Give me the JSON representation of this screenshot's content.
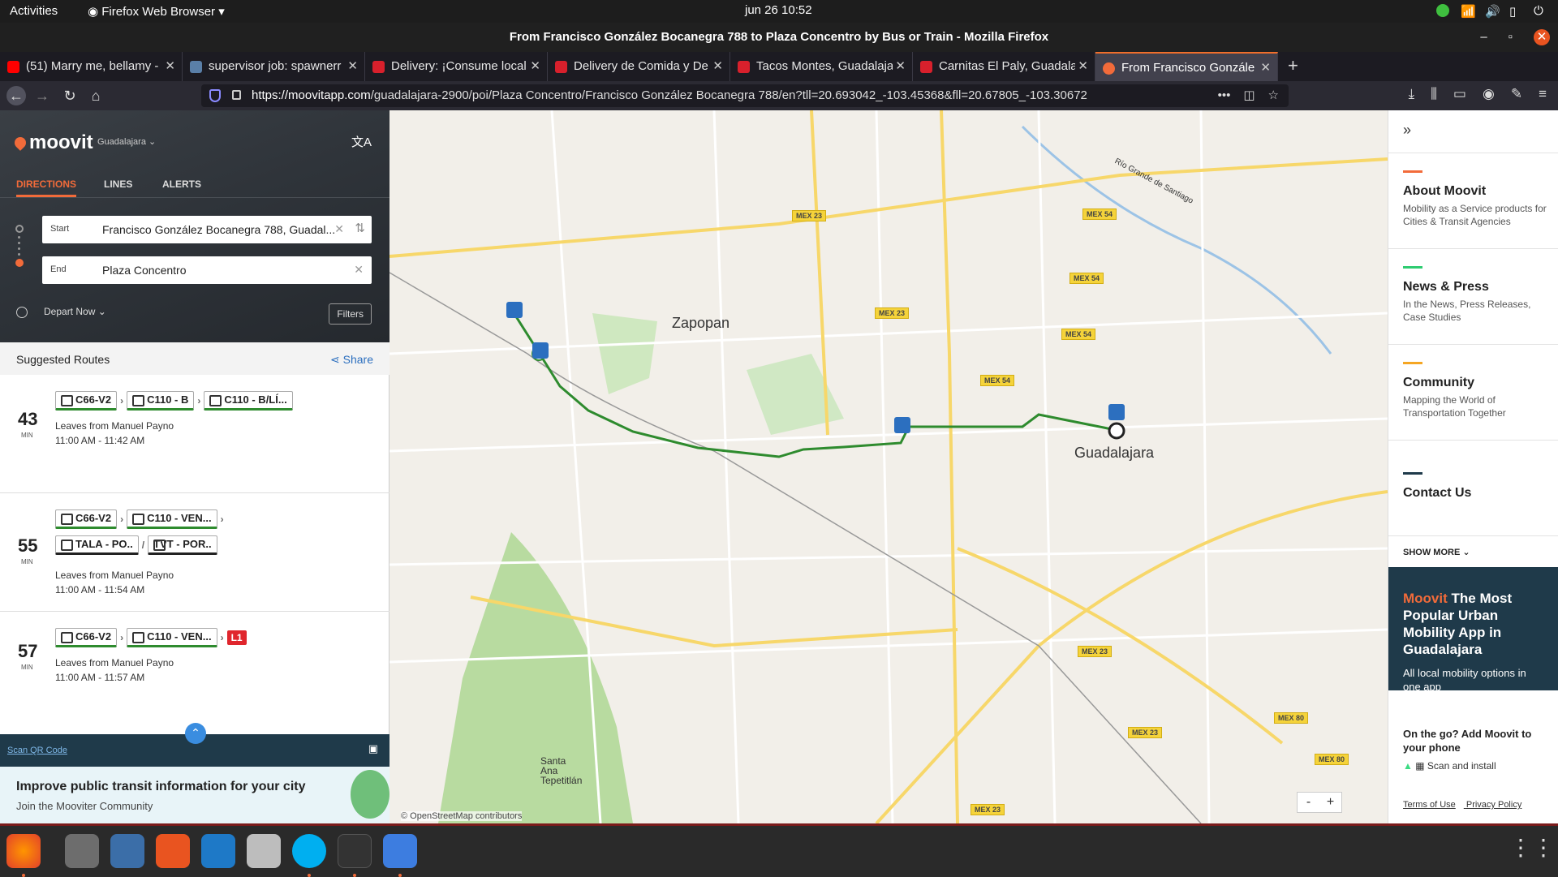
{
  "system": {
    "activities": "Activities",
    "app_menu": "Firefox Web Browser",
    "clock": "jun 26  10:52"
  },
  "window": {
    "title": "From Francisco González Bocanegra 788 to Plaza Concentro by Bus or Train - Mozilla Firefox"
  },
  "tabs": [
    {
      "title": "(51) Marry me, bellamy -",
      "color": "#ff0000"
    },
    {
      "title": "supervisor job: spawnerr",
      "color": "#5a7fa8"
    },
    {
      "title": "Delivery: ¡Consume local",
      "color": "#d8202c"
    },
    {
      "title": "Delivery de Comida y De",
      "color": "#d8202c"
    },
    {
      "title": "Tacos Montes, Guadalaja",
      "color": "#d8202c"
    },
    {
      "title": "Carnitas El Paly, Guadala",
      "color": "#d8202c"
    },
    {
      "title": "From Francisco Gonzále",
      "color": "#f26b3a"
    }
  ],
  "url": {
    "host": "https://moovitapp.com",
    "path": "/guadalajara-2900/poi/Plaza Concentro/Francisco González Bocanegra 788/en?tll=20.693042_-103.45368&fll=20.67805_-103.30672"
  },
  "moovit": {
    "logo": "moovit",
    "city": "Guadalajara",
    "lang_icon": "文A",
    "tabs": [
      "DIRECTIONS",
      "LINES",
      "ALERTS"
    ],
    "start_label": "Start",
    "start_value": "Francisco González Bocanegra 788, Guadal...",
    "end_label": "End",
    "end_value": "Plaza Concentro",
    "depart": "Depart Now",
    "filters": "Filters",
    "suggested": "Suggested Routes",
    "share": "Share",
    "routes": [
      {
        "min": "43",
        "unit": "MIN",
        "chips": [
          "C66-V2",
          "C110 - B",
          "C110 - B/LÍ..."
        ],
        "leaves": "Leaves from Manuel Payno",
        "time": "11:00 AM  -  11:42 AM"
      },
      {
        "min": "55",
        "unit": "MIN",
        "chips": [
          "C66-V2",
          "C110 - VEN...",
          "TALA - PO..",
          "TVT - POR.."
        ],
        "leaves": "Leaves from Manuel Payno",
        "time": "11:00 AM  -  11:54 AM"
      },
      {
        "min": "57",
        "unit": "MIN",
        "chips": [
          "C66-V2",
          "C110 - VEN..."
        ],
        "extra": "L1",
        "leaves": "Leaves from Manuel Payno",
        "time": "11:00 AM  -  11:57 AM"
      }
    ],
    "scan_qr": "Scan QR Code",
    "promo_title": "Improve public transit information for your city",
    "promo_sub": "Join the Mooviter Community"
  },
  "map": {
    "labels": {
      "zapopan": "Zapopan",
      "guadalajara": "Guadalajara",
      "santa_ana": "Santa\nAna\nTepetitlán",
      "rio": "Río Grande de Santiago"
    },
    "shields": [
      "MEX 23",
      "MEX 54",
      "MEX 54",
      "MEX 23",
      "MEX 54",
      "MEX 54",
      "MEX 23",
      "MEX 23",
      "MEX 80",
      "MEX 80",
      "MEX 23"
    ],
    "attribution": "© OpenStreetMap contributors",
    "zoom_out": "-",
    "zoom_in": "+"
  },
  "right": {
    "sections": [
      {
        "title": "About Moovit",
        "desc": "Mobility as a Service products for Cities & Transit Agencies",
        "color": "#f26b3a"
      },
      {
        "title": "News & Press",
        "desc": "In the News, Press Releases, Case Studies",
        "color": "#2ecc71"
      },
      {
        "title": "Community",
        "desc": "Mapping the World of Transportation Together",
        "color": "#f5a623"
      },
      {
        "title": "Contact Us",
        "desc": "",
        "color": "#1f3a4a"
      }
    ],
    "show_more": "SHOW MORE",
    "promo_brand": "Moovit",
    "promo_title": " The Most Popular Urban Mobility App in Guadalajara",
    "promo_desc": "All local mobility options in one app",
    "onthego": "On the go? Add Moovit to your phone",
    "scan_install": "Scan and install",
    "terms": "Terms of Use",
    "privacy": "Privacy Policy"
  }
}
